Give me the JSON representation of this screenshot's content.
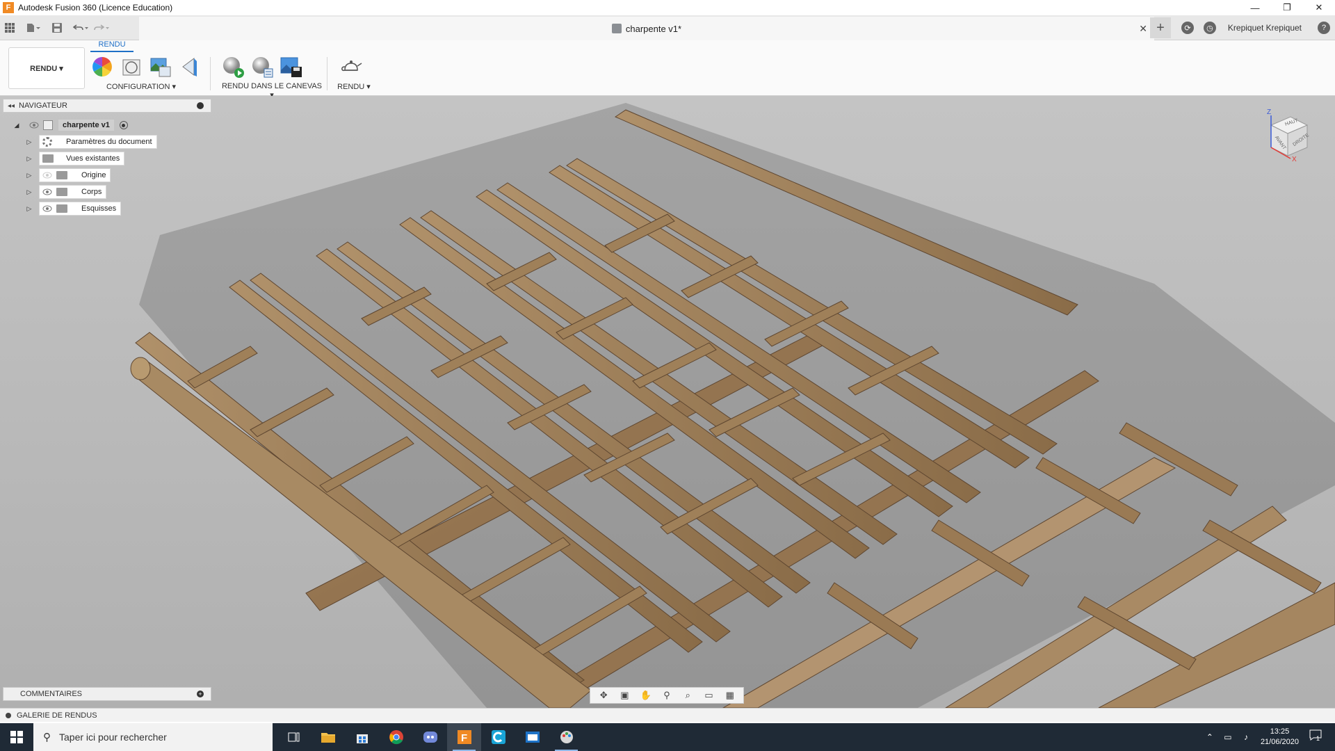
{
  "window": {
    "title": "Autodesk Fusion 360 (Licence Education)",
    "minimize_glyph": "—",
    "restore_glyph": "❐",
    "close_glyph": "✕"
  },
  "document_tab": {
    "name": "charpente v1*",
    "close_glyph": "✕"
  },
  "user": {
    "name": "Krepiquet Krepiquet"
  },
  "ribbon": {
    "active_tab": "RENDU",
    "workspace": "RENDU ▾",
    "groups": {
      "configuration": "CONFIGURATION ▾",
      "canvas_render": "RENDU DANS LE CANEVAS ▾",
      "render": "RENDU ▾"
    }
  },
  "navigator": {
    "title": "NAVIGATEUR",
    "collapse_glyph": "◂◂",
    "root": "charpente v1",
    "items": [
      {
        "label": "Paramètres du document",
        "icon": "gear-icon"
      },
      {
        "label": "Vues existantes",
        "icon": "folder-icon"
      },
      {
        "label": "Origine",
        "icon": "folder-icon"
      },
      {
        "label": "Corps",
        "icon": "folder-icon"
      },
      {
        "label": "Esquisses",
        "icon": "folder-icon"
      }
    ]
  },
  "viewcube": {
    "top": "HAUT",
    "front": "AVANT",
    "right": "DROITE",
    "axis_z": "Z",
    "axis_x": "X"
  },
  "comments": {
    "title": "COMMENTAIRES"
  },
  "gallery": {
    "title": "GALERIE DE RENDUS"
  },
  "taskbar": {
    "search_placeholder": "Taper ici pour rechercher",
    "time": "13:25",
    "date": "21/06/2020",
    "notification_count": "1"
  },
  "colors": {
    "accent": "#1e6fc6",
    "wood": "#9a7b55",
    "wood_dark": "#6f5538",
    "viewport_bg": "#bababa",
    "taskbar_bg": "#1f2a36"
  }
}
